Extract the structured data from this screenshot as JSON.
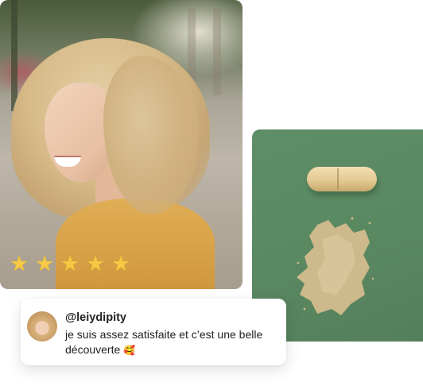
{
  "rating": {
    "stars": 5,
    "max": 5,
    "symbol": "★",
    "color": "#f6c843"
  },
  "review": {
    "username": "@leiydipity",
    "text": "je suis assez satisfaite et c’est une belle découverte",
    "emoji": "🥰",
    "avatar_icon": "avatar-photo"
  },
  "colors": {
    "green_card": "#5a8961",
    "capsule": "#e3c993"
  }
}
